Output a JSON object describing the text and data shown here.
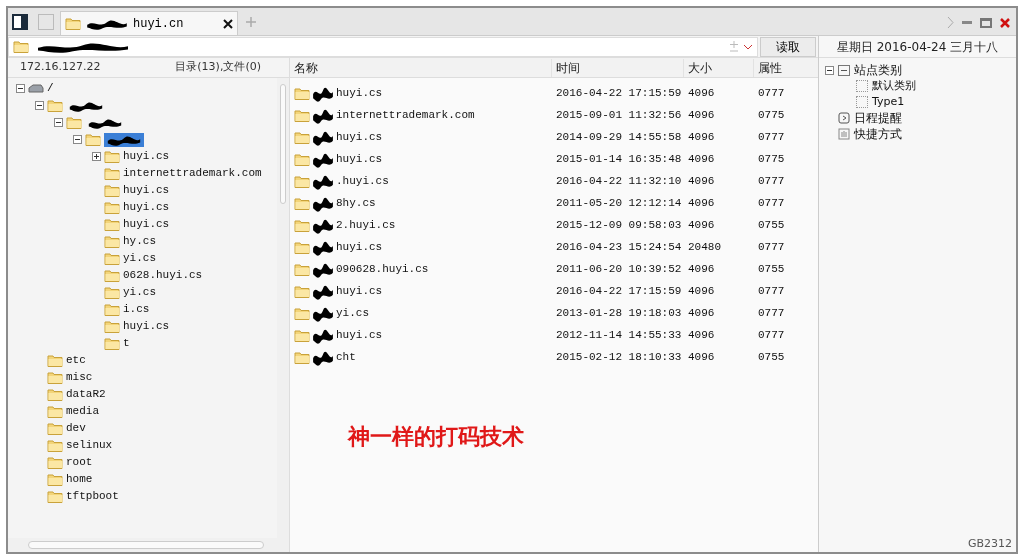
{
  "tabs": [
    {
      "label": "huyi.cn",
      "selected": true,
      "redacted": true
    }
  ],
  "address": {
    "redacted": true
  },
  "read_button": "读取",
  "date_line": "星期日 2016-04-24 三月十八",
  "tree_header": {
    "host": "172.16.127.22",
    "summary": "目录(13),文件(0)"
  },
  "tree": [
    {
      "label": "/",
      "kind": "drive",
      "expanded": true,
      "children": [
        {
          "redacted": true,
          "kind": "folder",
          "expanded": true,
          "children": [
            {
              "redacted": true,
              "kind": "folder",
              "expanded": true,
              "children": [
                {
                  "redacted": true,
                  "kind": "folder",
                  "expanded": true,
                  "selected": true,
                  "children": [
                    {
                      "label": "huyi.cs",
                      "kind": "folder",
                      "expanded": false
                    },
                    {
                      "label": "internettrademark.com",
                      "kind": "folder"
                    },
                    {
                      "label": "huyi.cs",
                      "kind": "folder"
                    },
                    {
                      "label": "huyi.cs",
                      "kind": "folder"
                    },
                    {
                      "label": "huyi.cs",
                      "kind": "folder"
                    },
                    {
                      "label": "hy.cs",
                      "kind": "folder"
                    },
                    {
                      "label": "yi.cs",
                      "kind": "folder"
                    },
                    {
                      "label": "0628.huyi.cs",
                      "kind": "folder"
                    },
                    {
                      "label": "yi.cs",
                      "kind": "folder"
                    },
                    {
                      "label": "i.cs",
                      "kind": "folder"
                    },
                    {
                      "label": "huyi.cs",
                      "kind": "folder"
                    },
                    {
                      "label": "t",
                      "kind": "folder"
                    }
                  ]
                }
              ]
            }
          ]
        },
        {
          "label": "etc",
          "kind": "folder"
        },
        {
          "label": "misc",
          "kind": "folder"
        },
        {
          "label": "dataR2",
          "kind": "folder"
        },
        {
          "label": "media",
          "kind": "folder"
        },
        {
          "label": "dev",
          "kind": "folder"
        },
        {
          "label": "selinux",
          "kind": "folder"
        },
        {
          "label": "root",
          "kind": "folder"
        },
        {
          "label": "home",
          "kind": "folder"
        },
        {
          "label": "tftpboot",
          "kind": "folder"
        }
      ]
    }
  ],
  "table": {
    "columns": [
      "名称",
      "时间",
      "大小",
      "属性"
    ],
    "rows": [
      {
        "name": "huyi.cs",
        "time": "2016-04-22 17:15:59",
        "size": "4096",
        "mode": "0777"
      },
      {
        "name": "internettrademark.com",
        "time": "2015-09-01 11:32:56",
        "size": "4096",
        "mode": "0775"
      },
      {
        "name": "huyi.cs",
        "time": "2014-09-29 14:55:58",
        "size": "4096",
        "mode": "0777"
      },
      {
        "name": "huyi.cs",
        "time": "2015-01-14 16:35:48",
        "size": "4096",
        "mode": "0775"
      },
      {
        "name": ".huyi.cs",
        "time": "2016-04-22 11:32:10",
        "size": "4096",
        "mode": "0777"
      },
      {
        "name": "8hy.cs",
        "time": "2011-05-20 12:12:14",
        "size": "4096",
        "mode": "0777"
      },
      {
        "name": "2.huyi.cs",
        "time": "2015-12-09 09:58:03",
        "size": "4096",
        "mode": "0755"
      },
      {
        "name": "huyi.cs",
        "time": "2016-04-23 15:24:54",
        "size": "20480",
        "mode": "0777"
      },
      {
        "name": "090628.huyi.cs",
        "time": "2011-06-20 10:39:52",
        "size": "4096",
        "mode": "0755"
      },
      {
        "name": "huyi.cs",
        "time": "2016-04-22 17:15:59",
        "size": "4096",
        "mode": "0777"
      },
      {
        "name": "yi.cs",
        "time": "2013-01-28 19:18:03",
        "size": "4096",
        "mode": "0777"
      },
      {
        "name": "huyi.cs",
        "time": "2012-11-14 14:55:33",
        "size": "4096",
        "mode": "0777"
      },
      {
        "name": "cht",
        "time": "2015-02-12 18:10:33",
        "size": "4096",
        "mode": "0755"
      }
    ]
  },
  "annotation": "神一样的打码技术",
  "side_tree": [
    {
      "label": "站点类别",
      "kind": "category",
      "expanded": true,
      "children": [
        {
          "label": "默认类别",
          "kind": "item"
        },
        {
          "label": "Type1",
          "kind": "item"
        }
      ]
    },
    {
      "label": "日程提醒",
      "kind": "schedule"
    },
    {
      "label": "快捷方式",
      "kind": "shortcut"
    }
  ],
  "status": "GB2312"
}
